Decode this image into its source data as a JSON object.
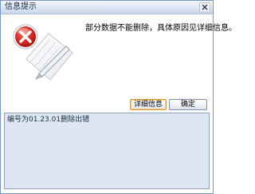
{
  "window": {
    "title": "信息提示"
  },
  "message": {
    "text": "部分数据不能删除，具体原因见详细信息。"
  },
  "buttons": {
    "details_label": "详细信息",
    "ok_label": "确定"
  },
  "details": {
    "text": "编号为01.23.01删除出错"
  },
  "icons": {
    "close": "close-icon",
    "error": "error-icon",
    "document": "document-icon",
    "pen": "pen-icon"
  },
  "colors": {
    "error_red": "#d8302a",
    "title_bar": "#dde6f3",
    "detail_background": "#dde7f3"
  }
}
